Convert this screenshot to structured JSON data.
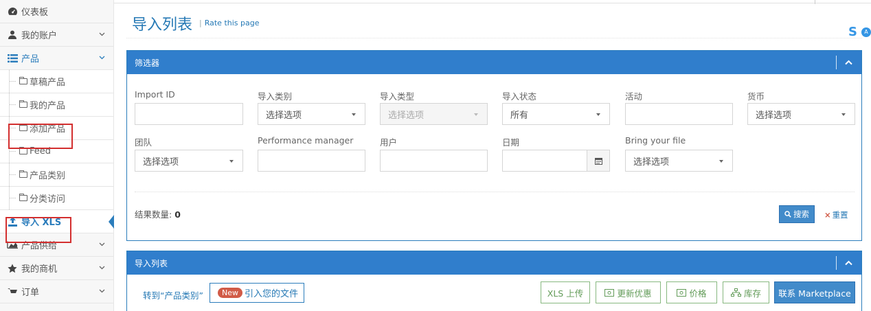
{
  "sidebar": {
    "items": [
      {
        "label": "仪表板",
        "icon": "dashboard-icon"
      },
      {
        "label": "我的账户",
        "icon": "user-icon"
      },
      {
        "label": "产品",
        "icon": "list-icon"
      },
      {
        "label": "产品供给",
        "icon": "area-chart-icon"
      },
      {
        "label": "我的商机",
        "icon": "star-icon"
      },
      {
        "label": "订单",
        "icon": "cart-icon"
      }
    ],
    "sub_items": [
      "草稿产品",
      "我的产品",
      "添加产品",
      "Feed",
      "产品类别",
      "分类访问"
    ],
    "active": {
      "label": "导入 XLS",
      "icon": "upload-icon"
    }
  },
  "header": {
    "title": "导入列表",
    "rate_label": "Rate this page"
  },
  "filter_panel": {
    "title": "筛选器",
    "fields": {
      "import_id": "Import ID",
      "import_category": "导入类别",
      "import_type": "导入类型",
      "import_status": "导入状态",
      "activity": "活动",
      "currency": "货币",
      "team": "团队",
      "performance_manager": "Performance manager",
      "user": "用户",
      "date": "日期",
      "bring_file": "Bring your file"
    },
    "select_placeholder": "选择选项",
    "status_value": "所有",
    "result_label": "结果数量: ",
    "result_count": "0",
    "search_label": "搜索",
    "reset_label": "重置"
  },
  "list_panel": {
    "title": "导入列表",
    "goto_category": "转到“产品类别”",
    "new_badge": "New",
    "import_file": "引入您的文件",
    "xls_upload": "XLS 上传",
    "update_offer": "更新优惠",
    "price": "价格",
    "stock": "库存",
    "contact": "联系 Marketplace"
  },
  "colors": {
    "primary": "#307ecc",
    "link": "#2679b5",
    "highlight": "#d32f2f",
    "success": "#87b87f",
    "danger": "#d15b47"
  }
}
